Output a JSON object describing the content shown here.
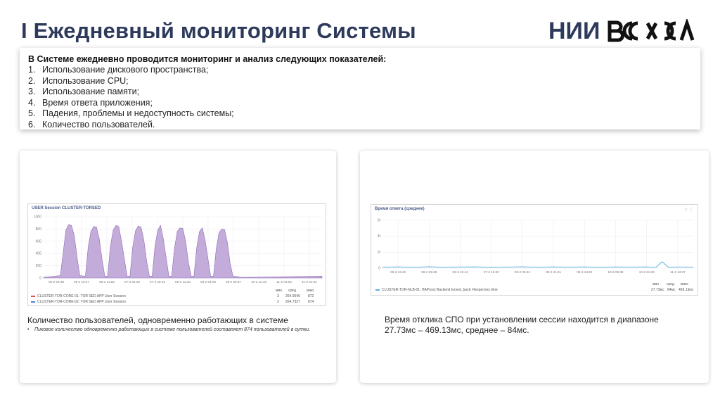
{
  "header": {
    "title": "I Ежедневный мониторинг Системы",
    "logo_text": "НИИ",
    "logo_mark_text": "ВОСХОД"
  },
  "info": {
    "heading": "В Системе ежедневно проводится мониторинг и анализ следующих показателей:",
    "items": [
      {
        "num": "1.",
        "text": "Использование дискового пространства;"
      },
      {
        "num": "2.",
        "text": "Использование CPU;"
      },
      {
        "num": "3.",
        "text": "Использование памяти;"
      },
      {
        "num": "4.",
        "text": "Время ответа приложения;"
      },
      {
        "num": "5.",
        "text": "Падения, проблемы и недоступность системы;"
      },
      {
        "num": "6.",
        "text": "Количество пользователей."
      }
    ]
  },
  "left_card": {
    "caption": "Количество пользователей, одновременно работающих в системе",
    "note_bullet": "•",
    "note": "Пиковое количество одновременно работающих в системе пользователей составляет 874 пользователей в сутки.",
    "legend_header": {
      "min": "мин",
      "avg": "сред",
      "max": "макс"
    },
    "legend": [
      {
        "name": "CLUSTER-TOR-CORE-01: TOR SED APP User Session",
        "min": "3",
        "avg": "264.9645",
        "max": "872",
        "color": "#d9534f"
      },
      {
        "name": "CLUSTER-TOR-CORE-02: TOR SED APP User Session",
        "min": "2",
        "avg": "264.7337",
        "max": "874",
        "color": "#5b7bd5"
      }
    ]
  },
  "right_card": {
    "caption": "Время отклика СПО при установлении сессии находится в диапазоне 27.73мс – 469.13мс, среднее – 84мс.",
    "legend_header": {
      "min": "мин",
      "avg": "сред",
      "max": "макс"
    },
    "legend": [
      {
        "name": "CLUSTER-TOR-NLB-01: HAProxy Backend torsed_back: Responses time",
        "min": "27.73мс",
        "avg": "84мс",
        "max": "469.13мс",
        "color": "#5bb0e0"
      }
    ]
  },
  "chart_data": [
    {
      "type": "area",
      "title": "USER Session CLUSTER-TORSED",
      "ylim": [
        0,
        1000
      ],
      "yticks": [
        0,
        200,
        400,
        600,
        800,
        1000
      ],
      "xticks": [
        "05-2 03:38",
        "05-2 19:47",
        "06-2 11:55",
        "07-2 04:03",
        "07-2 20:12",
        "08-2 12:20",
        "09-2 04:28",
        "09-2 20:37",
        "10-2 12:45",
        "11-2 04:53",
        "11-2 21:01"
      ],
      "color": "#b89dd4",
      "series": [
        {
          "x": [
            0,
            0.06,
            0.07,
            0.08,
            0.09,
            0.1,
            0.11,
            0.12,
            0.13,
            0.15,
            0.16,
            0.17,
            0.18,
            0.19,
            0.2,
            0.21,
            0.22,
            0.23,
            0.24,
            0.25,
            0.26,
            0.27,
            0.28,
            0.3,
            0.31,
            0.32,
            0.33,
            0.34,
            0.35,
            0.36,
            0.37,
            0.38,
            0.39,
            0.4,
            0.41,
            0.42,
            0.43,
            0.45,
            0.46,
            0.47,
            0.48,
            0.49,
            0.5,
            0.51,
            0.52,
            0.53,
            0.54,
            0.55,
            0.56,
            0.57,
            0.58,
            0.6,
            0.61,
            0.62,
            0.63,
            0.64,
            0.65,
            0.66,
            0.67,
            0.68,
            0.69,
            0.7,
            0.71,
            0.72,
            1.0
          ],
          "values": [
            10,
            40,
            400,
            780,
            874,
            860,
            700,
            350,
            40,
            30,
            500,
            760,
            840,
            830,
            640,
            300,
            30,
            30,
            520,
            780,
            860,
            840,
            600,
            30,
            30,
            500,
            770,
            850,
            830,
            620,
            280,
            30,
            30,
            520,
            780,
            860,
            640,
            30,
            30,
            480,
            760,
            820,
            810,
            600,
            260,
            30,
            30,
            500,
            760,
            820,
            620,
            30,
            30,
            470,
            740,
            800,
            790,
            580,
            240,
            30,
            25,
            20,
            10,
            10,
            30
          ]
        }
      ]
    },
    {
      "type": "line",
      "title": "Время ответа (среднее)",
      "ylim": [
        0,
        60
      ],
      "ytick_labels": [
        "0",
        "2t",
        "4t",
        "6t"
      ],
      "xticks": [
        "05-2 13:40",
        "06-2 05:45",
        "06-2 21:44",
        "07-2 13:40",
        "08-2 05:42",
        "08-2 21:41",
        "09-2 13:40",
        "10-2 05:38",
        "10-2 21:33",
        "11-2 13:37"
      ],
      "color": "#5bb0e0",
      "series": [
        {
          "x": [
            0,
            0.05,
            0.1,
            0.15,
            0.2,
            0.25,
            0.3,
            0.35,
            0.4,
            0.45,
            0.5,
            0.55,
            0.6,
            0.65,
            0.7,
            0.75,
            0.8,
            0.85,
            0.88,
            0.9,
            0.92,
            0.95,
            1.0
          ],
          "values": [
            1.2,
            1.5,
            1.0,
            1.8,
            1.1,
            1.4,
            1.6,
            1.0,
            1.3,
            1.7,
            1.1,
            1.5,
            1.2,
            1.6,
            1.0,
            1.4,
            1.3,
            1.5,
            1.1,
            8.0,
            1.2,
            1.4,
            1.3
          ]
        }
      ]
    }
  ]
}
